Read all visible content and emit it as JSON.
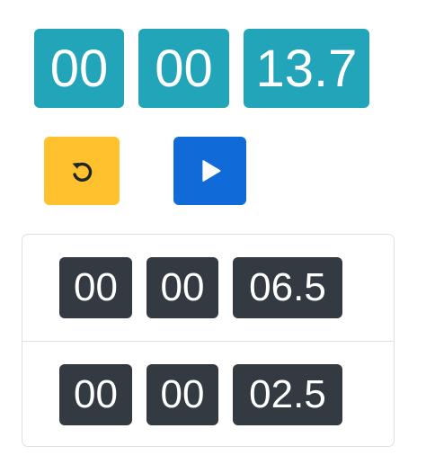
{
  "timer": {
    "hours": "00",
    "minutes": "00",
    "seconds": "13.7"
  },
  "controls": {
    "reset_icon": "reset-icon",
    "play_icon": "play-icon",
    "colors": {
      "reset": "#ffc22e",
      "play": "#106ad8",
      "timer": "#22a5b8",
      "lap": "#343a41"
    }
  },
  "laps": [
    {
      "hours": "00",
      "minutes": "00",
      "seconds": "06.5"
    },
    {
      "hours": "00",
      "minutes": "00",
      "seconds": "02.5"
    }
  ]
}
